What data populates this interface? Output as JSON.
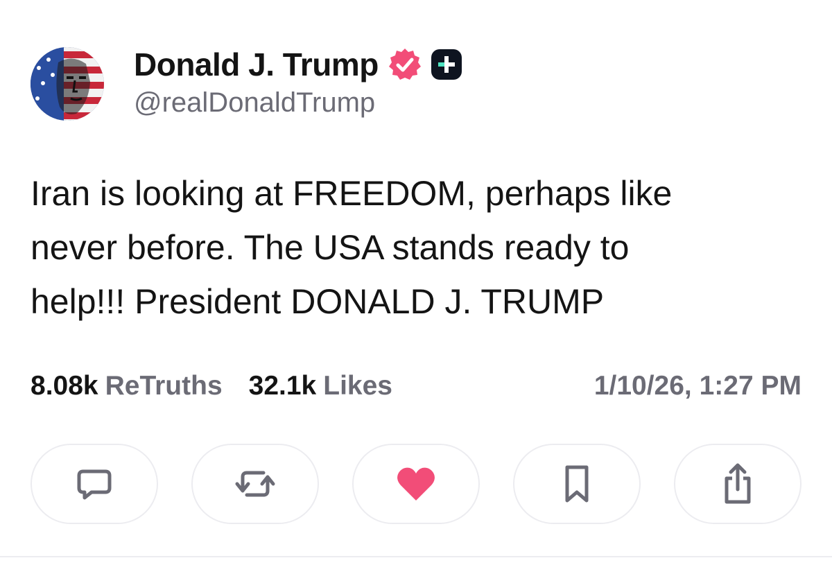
{
  "author": {
    "display_name": "Donald J. Trump",
    "handle": "@realDonaldTrump",
    "verified_icon": "verified-badge-icon",
    "badge_icon": "truth-plus-icon"
  },
  "post": {
    "lines": [
      "Iran is looking at FREEDOM, perhaps like",
      "never before. The USA stands ready to",
      "help!!! President DONALD J. TRUMP"
    ]
  },
  "stats": {
    "retruths_count": "8.08k",
    "retruths_label": "ReTruths",
    "likes_count": "32.1k",
    "likes_label": "Likes",
    "timestamp": "1/10/26, 1:27 PM"
  },
  "actions": [
    {
      "name": "reply",
      "icon": "comment-icon"
    },
    {
      "name": "retruth",
      "icon": "repost-icon"
    },
    {
      "name": "like",
      "icon": "heart-icon",
      "active": true
    },
    {
      "name": "bookmark",
      "icon": "bookmark-icon"
    },
    {
      "name": "share",
      "icon": "share-icon"
    }
  ],
  "colors": {
    "text_primary": "#141414",
    "text_secondary": "#6b6b75",
    "accent_like": "#f24d78",
    "verified": "#f24d78",
    "icon_gray": "#6b6b75",
    "border": "#ececf0"
  }
}
